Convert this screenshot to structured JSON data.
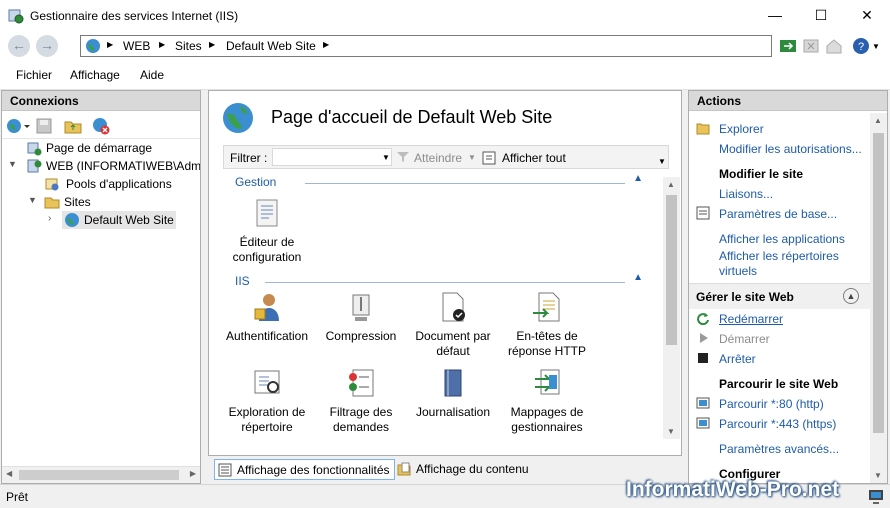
{
  "window": {
    "title": "Gestionnaire des services Internet (IIS)",
    "minimize": "—",
    "maximize": "☐",
    "close": "✕"
  },
  "nav": {
    "back": "←",
    "forward": "→",
    "breadcrumb": [
      "WEB",
      "Sites",
      "Default Web Site"
    ]
  },
  "menu": {
    "file": "Fichier",
    "view": "Affichage",
    "help": "Aide"
  },
  "connections": {
    "header": "Connexions",
    "tree": [
      {
        "label": "Page de démarrage"
      },
      {
        "label": "WEB (INFORMATIWEB\\Admin"
      },
      {
        "label": "Pools d'applications"
      },
      {
        "label": "Sites"
      },
      {
        "label": "Default Web Site"
      }
    ]
  },
  "center": {
    "title": "Page d'accueil de Default Web Site",
    "filter_label": "Filtrer :",
    "filter_value": "",
    "go_label": "Atteindre",
    "show_all_label": "Afficher tout",
    "groups": [
      {
        "name": "Gestion",
        "features": [
          {
            "label": "Éditeur de configuration",
            "icon": "config-editor-icon"
          }
        ]
      },
      {
        "name": "IIS",
        "features": [
          {
            "label": "Authentification",
            "icon": "authentication-icon"
          },
          {
            "label": "Compression",
            "icon": "compression-icon"
          },
          {
            "label": "Document par défaut",
            "icon": "default-document-icon"
          },
          {
            "label": "En-têtes de réponse HTTP",
            "icon": "http-headers-icon"
          },
          {
            "label": "Exploration de répertoire",
            "icon": "directory-browsing-icon"
          },
          {
            "label": "Filtrage des demandes",
            "icon": "request-filtering-icon"
          },
          {
            "label": "Journalisation",
            "icon": "logging-icon"
          },
          {
            "label": "Mappages de gestionnaires",
            "icon": "handler-mappings-icon"
          }
        ]
      }
    ],
    "tab_features": "Affichage des fonctionnalités",
    "tab_content": "Affichage du contenu"
  },
  "actions": {
    "header": "Actions",
    "explore": "Explorer",
    "edit_permissions": "Modifier les autorisations...",
    "edit_site_title": "Modifier le site",
    "bindings": "Liaisons...",
    "basic_settings": "Paramètres de base...",
    "view_apps": "Afficher les applications",
    "view_vdirs_1": "Afficher les répertoires",
    "view_vdirs_2": "virtuels",
    "manage_site_title": "Gérer le site Web",
    "restart": "Redémarrer",
    "start": "Démarrer",
    "stop": "Arrêter",
    "browse_title": "Parcourir le site Web",
    "browse_80": "Parcourir *:80 (http)",
    "browse_443": "Parcourir *:443 (https)",
    "advanced_settings": "Paramètres avancés...",
    "configure_title": "Configurer"
  },
  "status": {
    "text": "Prêt"
  },
  "watermark": "InformatiWeb-Pro.net",
  "colors": {
    "link": "#1f5ca8",
    "panel_header": "#d9d9d9",
    "selected": "#e5e5e5"
  }
}
